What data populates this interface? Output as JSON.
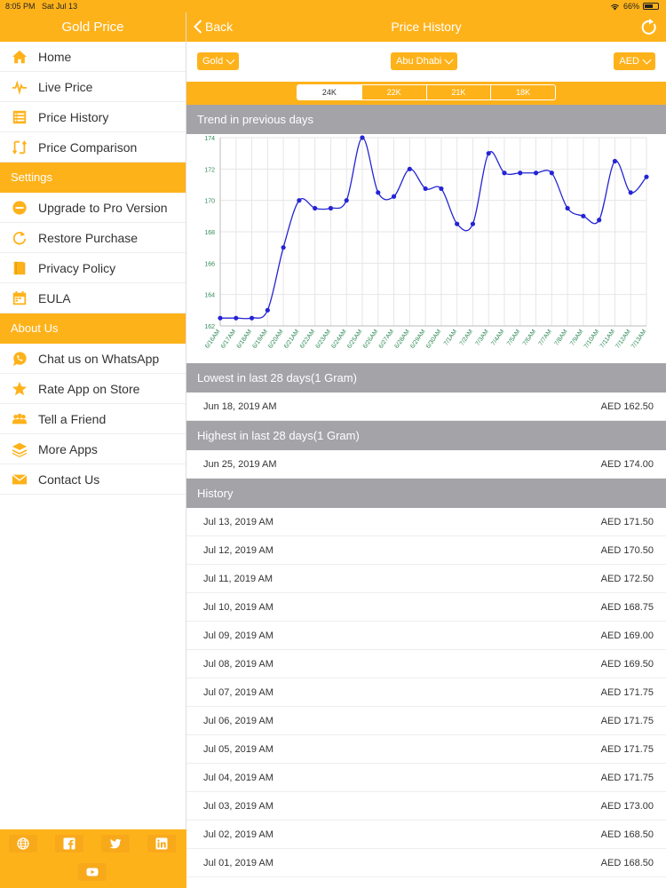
{
  "status": {
    "time": "8:05 PM",
    "date": "Sat Jul 13",
    "battery": "66%",
    "battery_level": 0.66
  },
  "sidebar": {
    "title": "Gold Price",
    "items_main": [
      {
        "label": "Home",
        "icon": "home-icon"
      },
      {
        "label": "Live Price",
        "icon": "pulse-icon"
      },
      {
        "label": "Price History",
        "icon": "list-icon"
      },
      {
        "label": "Price Comparison",
        "icon": "compare-icon"
      }
    ],
    "section_settings": "Settings",
    "items_settings": [
      {
        "label": "Upgrade to Pro Version",
        "icon": "minus-circle-icon"
      },
      {
        "label": "Restore Purchase",
        "icon": "restore-icon"
      },
      {
        "label": "Privacy Policy",
        "icon": "book-icon"
      },
      {
        "label": "EULA",
        "icon": "calendar-icon"
      }
    ],
    "section_about": "About Us",
    "items_about": [
      {
        "label": "Chat us on WhatsApp",
        "icon": "whatsapp-icon"
      },
      {
        "label": "Rate App on Store",
        "icon": "star-icon"
      },
      {
        "label": "Tell a Friend",
        "icon": "people-icon"
      },
      {
        "label": "More Apps",
        "icon": "layers-icon"
      },
      {
        "label": "Contact Us",
        "icon": "mail-icon"
      }
    ],
    "social": [
      "globe-icon",
      "facebook-icon",
      "twitter-icon",
      "linkedin-icon",
      "youtube-icon"
    ]
  },
  "header": {
    "back_label": "Back",
    "title": "Price History"
  },
  "selectors": {
    "metal": "Gold",
    "city": "Abu Dhabi",
    "currency": "AED"
  },
  "karats": {
    "options": [
      "24K",
      "22K",
      "21K",
      "18K"
    ],
    "selected": "24K"
  },
  "trend": {
    "title": "Trend in previous days"
  },
  "chart_data": {
    "type": "line",
    "x": [
      "6/16AM",
      "6/17AM",
      "6/18AM",
      "6/19AM",
      "6/20AM",
      "6/21AM",
      "6/22AM",
      "6/23AM",
      "6/24AM",
      "6/25AM",
      "6/26AM",
      "6/27AM",
      "6/28AM",
      "6/29AM",
      "6/30AM",
      "7/1AM",
      "7/2AM",
      "7/3AM",
      "7/4AM",
      "7/5AM",
      "7/6AM",
      "7/7AM",
      "7/8AM",
      "7/9AM",
      "7/10AM",
      "7/11AM",
      "7/12AM",
      "7/13AM"
    ],
    "values": [
      162.5,
      162.5,
      162.5,
      163.0,
      167.0,
      170.0,
      169.5,
      169.5,
      170.0,
      174.0,
      170.5,
      170.25,
      172.0,
      170.75,
      170.75,
      168.5,
      168.5,
      173.0,
      171.75,
      171.75,
      171.75,
      171.75,
      169.5,
      169.0,
      168.75,
      172.5,
      170.5,
      171.5
    ],
    "y_ticks": [
      162,
      164,
      166,
      168,
      170,
      172,
      174
    ],
    "ylim": [
      162,
      174
    ],
    "grid": true,
    "color": "#2424D4"
  },
  "lowest": {
    "title": "Lowest in last 28 days(1 Gram)",
    "date": "Jun 18, 2019 AM",
    "price": "AED 162.50"
  },
  "highest": {
    "title": "Highest in last 28 days(1 Gram)",
    "date": "Jun 25, 2019 AM",
    "price": "AED 174.00"
  },
  "history": {
    "title": "History",
    "rows": [
      {
        "date": "Jul 13, 2019 AM",
        "price": "AED 171.50"
      },
      {
        "date": "Jul 12, 2019 AM",
        "price": "AED 170.50"
      },
      {
        "date": "Jul 11, 2019 AM",
        "price": "AED 172.50"
      },
      {
        "date": "Jul 10, 2019 AM",
        "price": "AED 168.75"
      },
      {
        "date": "Jul 09, 2019 AM",
        "price": "AED 169.00"
      },
      {
        "date": "Jul 08, 2019 AM",
        "price": "AED 169.50"
      },
      {
        "date": "Jul 07, 2019 AM",
        "price": "AED 171.75"
      },
      {
        "date": "Jul 06, 2019 AM",
        "price": "AED 171.75"
      },
      {
        "date": "Jul 05, 2019 AM",
        "price": "AED 171.75"
      },
      {
        "date": "Jul 04, 2019 AM",
        "price": "AED 171.75"
      },
      {
        "date": "Jul 03, 2019 AM",
        "price": "AED 173.00"
      },
      {
        "date": "Jul 02, 2019 AM",
        "price": "AED 168.50"
      },
      {
        "date": "Jul 01, 2019 AM",
        "price": "AED 168.50"
      }
    ]
  },
  "colors": {
    "accent": "#FEB21A",
    "section": "#A4A3A8",
    "line": "#2424D4",
    "tick": "#2E8B57"
  }
}
